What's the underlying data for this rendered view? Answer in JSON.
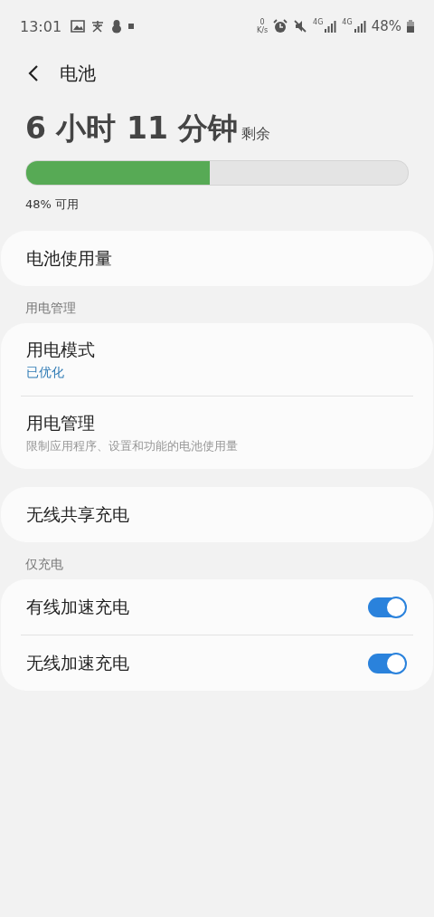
{
  "status_bar": {
    "time": "13:01",
    "net_speed_value": "0",
    "net_speed_unit": "K/s",
    "network_labels": [
      "4G",
      "4G"
    ],
    "battery": "48%"
  },
  "header": {
    "title": "电池"
  },
  "battery": {
    "time_remaining": "6 小时 11 分钟",
    "remaining_label": "剩余",
    "level": 0.48,
    "available": "48% 可用"
  },
  "sections": [
    {
      "items": [
        {
          "kind": "plain",
          "title": "电池使用量"
        }
      ]
    },
    {
      "heading": "用电管理",
      "items": [
        {
          "kind": "value",
          "title": "用电模式",
          "subtitle": "已优化"
        },
        {
          "kind": "description",
          "title": "用电管理",
          "subtitle": "限制应用程序、设置和功能的电池使用量"
        }
      ]
    },
    {
      "items": [
        {
          "kind": "plain",
          "title": "无线共享充电"
        }
      ]
    },
    {
      "heading": "仅充电",
      "items": [
        {
          "kind": "toggle",
          "title": "有线加速充电",
          "on": true
        },
        {
          "kind": "toggle",
          "title": "无线加速充电",
          "on": true
        }
      ]
    }
  ]
}
